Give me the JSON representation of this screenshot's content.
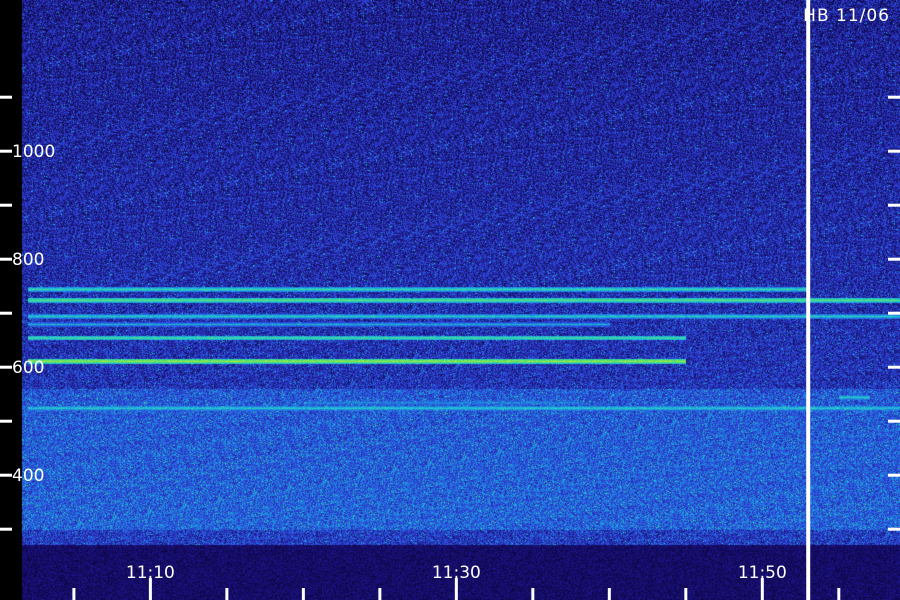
{
  "station_label": "HB 11/06",
  "chart_data": {
    "type": "heatmap",
    "title": "",
    "xlabel": "",
    "ylabel": "",
    "x_ticks": [
      {
        "time": "11:10",
        "label": "11:10"
      },
      {
        "time": "11:30",
        "label": "11:30"
      },
      {
        "time": "11:50",
        "label": "11:50"
      }
    ],
    "xlim": [
      "11:02",
      "11:59"
    ],
    "minor_x_ticks_minutes": 5,
    "y_ticks": [
      {
        "value": 1000,
        "label": "1000"
      },
      {
        "value": 800,
        "label": "800"
      },
      {
        "value": 600,
        "label": "600"
      },
      {
        "value": 400,
        "label": "400"
      }
    ],
    "minor_y_ticks": [
      1100,
      900,
      700,
      500,
      300
    ],
    "ylim": [
      280,
      1280
    ],
    "marker_line_time": "11:53",
    "colormap": [
      "#0a0330",
      "#1c1b8a",
      "#2f3fd8",
      "#1f7fe0",
      "#20c8d8",
      "#50e070",
      "#c8f020"
    ],
    "background_color": "#1a1570",
    "bands": [
      {
        "value": 745,
        "intensity": 0.75,
        "start": "11:02",
        "end": "11:53"
      },
      {
        "value": 725,
        "intensity": 0.85,
        "start": "11:02",
        "end": "11:59"
      },
      {
        "value": 695,
        "intensity": 0.7,
        "start": "11:02",
        "end": "11:59"
      },
      {
        "value": 680,
        "intensity": 0.6,
        "start": "11:02",
        "end": "11:40"
      },
      {
        "value": 655,
        "intensity": 0.8,
        "start": "11:02",
        "end": "11:45"
      },
      {
        "value": 612,
        "intensity": 0.95,
        "start": "11:02",
        "end": "11:45"
      },
      {
        "value": 535,
        "intensity": 0.55,
        "start": "11:20",
        "end": "11:38"
      },
      {
        "value": 525,
        "intensity": 0.7,
        "start": "11:02",
        "end": "11:59"
      },
      {
        "value": 545,
        "intensity": 0.7,
        "start": "11:55",
        "end": "11:57"
      }
    ],
    "bright_region": [
      300,
      560
    ]
  }
}
